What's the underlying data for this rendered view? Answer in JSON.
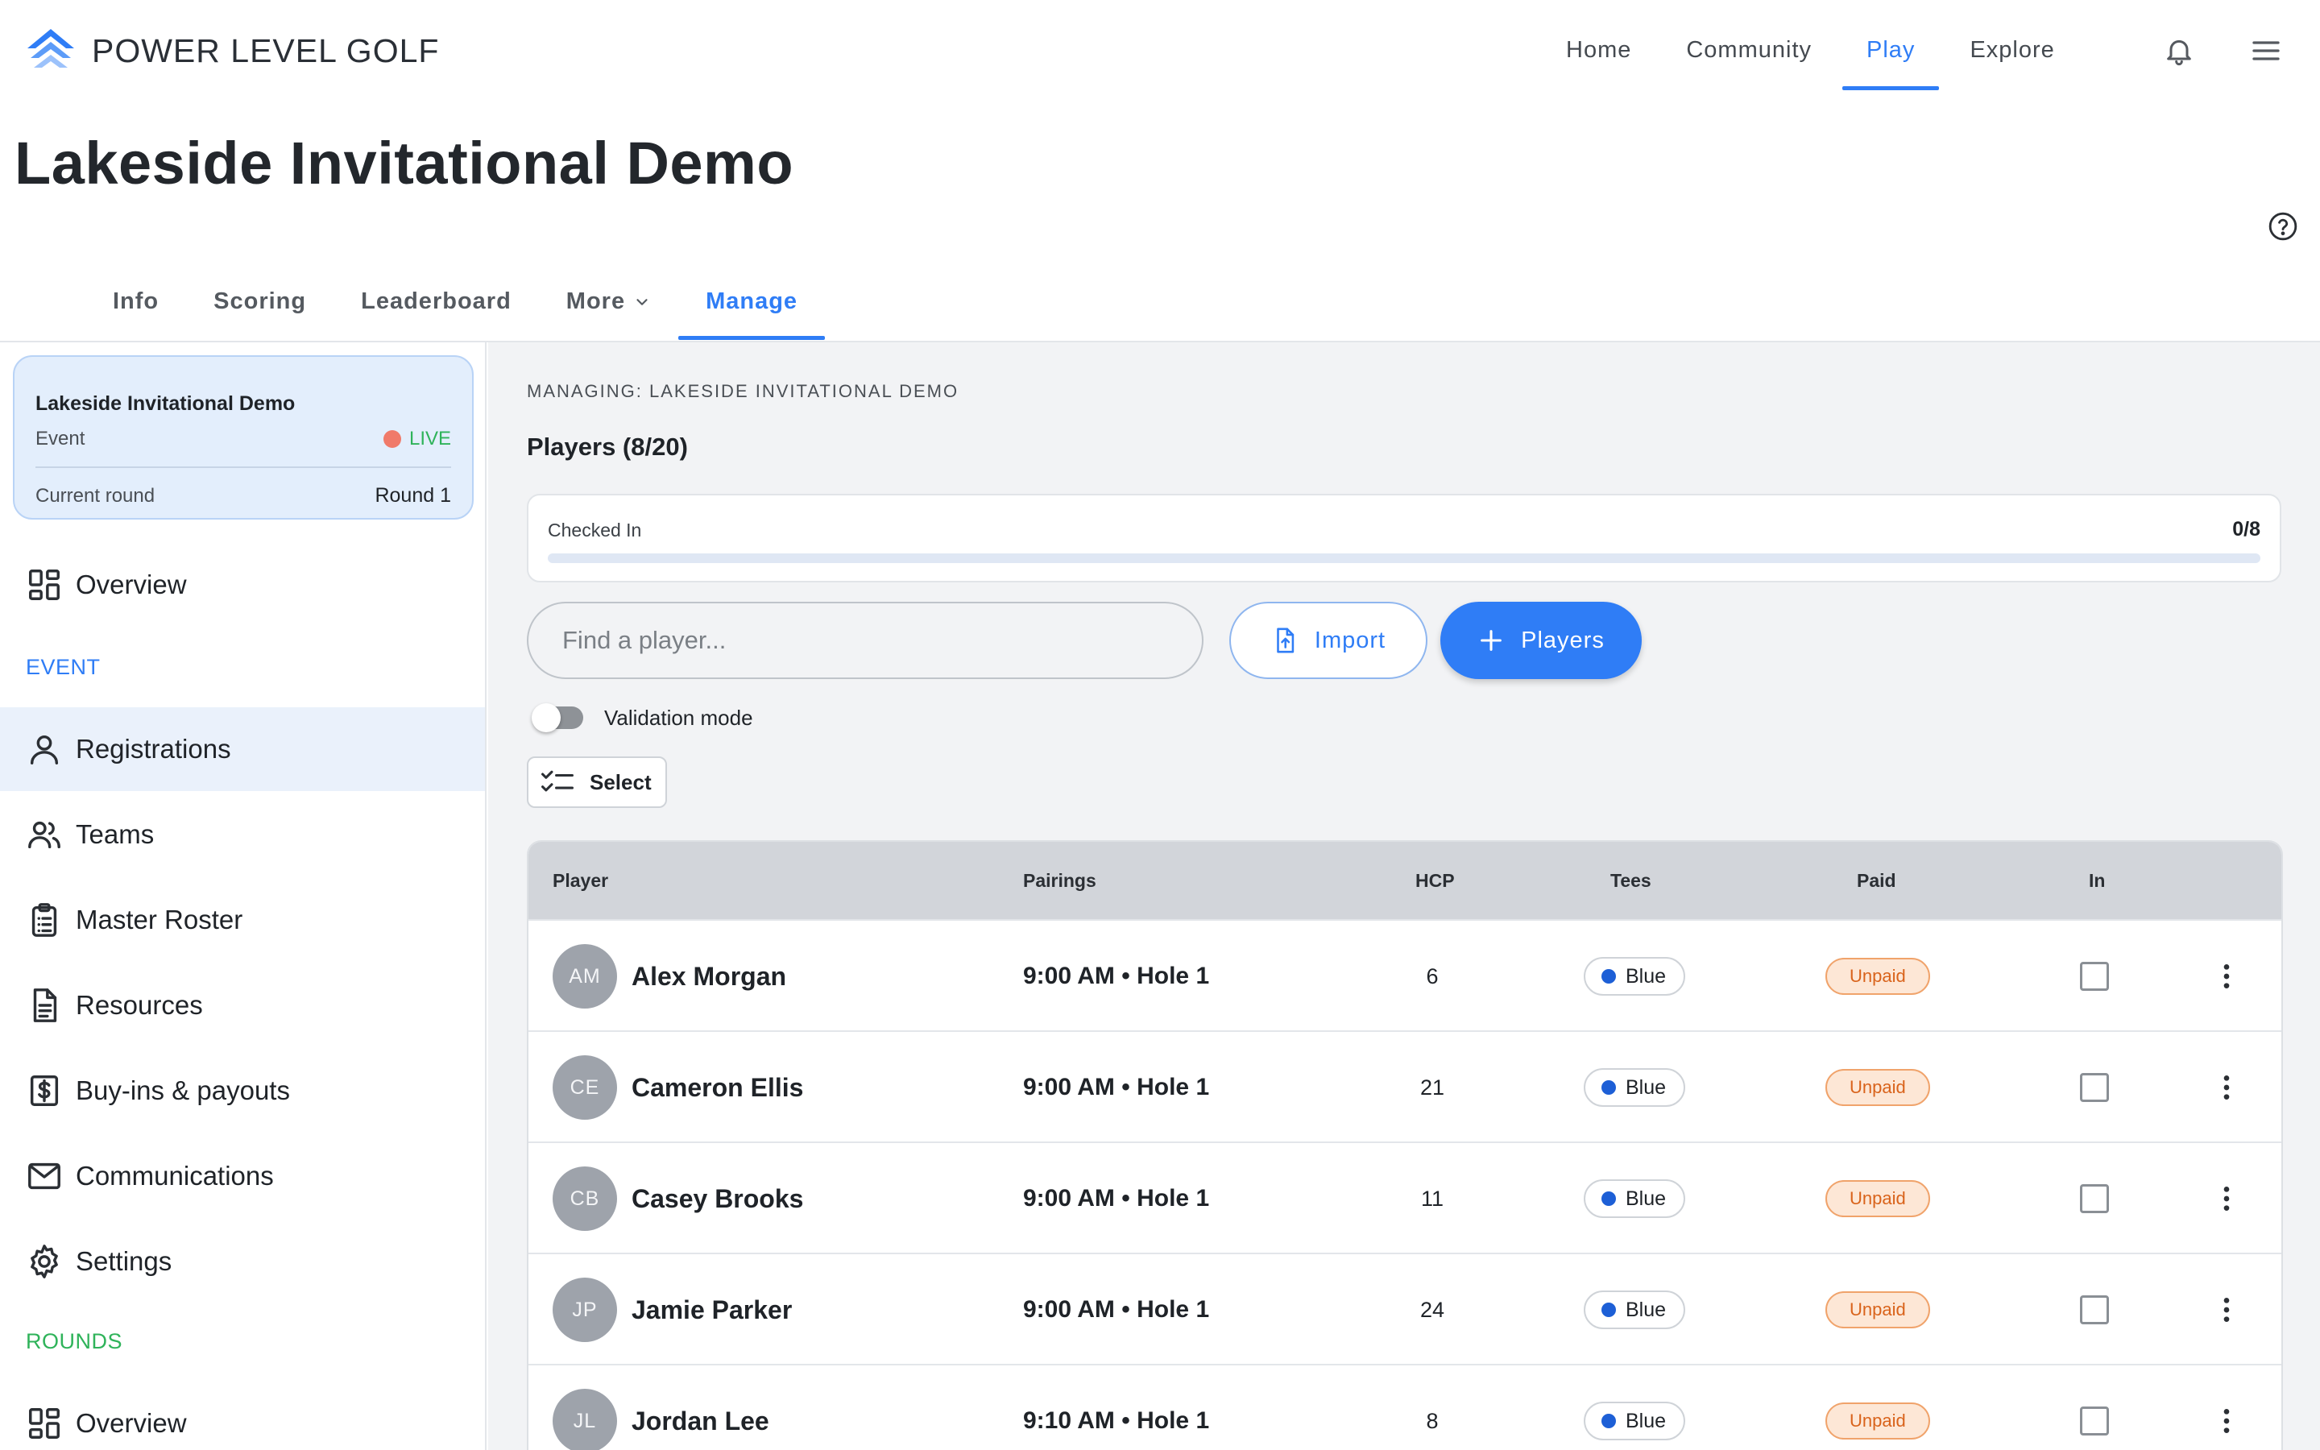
{
  "brand": {
    "name": "POWER LEVEL GOLF",
    "accent": "#2f7df6",
    "logo_icon": "chevron-stack-logo"
  },
  "topnav": {
    "items": [
      "Home",
      "Community",
      "Play",
      "Explore"
    ],
    "active": "Play",
    "notifications_icon": "bell-icon",
    "menu_icon": "hamburger-menu-icon"
  },
  "page": {
    "title": "Lakeside Invitational Demo",
    "help_icon": "question-circle-icon"
  },
  "tabs": {
    "items": [
      "Info",
      "Scoring",
      "Leaderboard",
      "More",
      "Manage"
    ],
    "active": "Manage"
  },
  "sidebar": {
    "event_card": {
      "title": "Lakeside Invitational Demo",
      "type": "Event",
      "status": "LIVE",
      "round_label": "Current round",
      "round_value": "Round 1"
    },
    "overview_label": "Overview",
    "event_section": "EVENT",
    "event_items": [
      {
        "label": "Registrations",
        "icon": "person-icon",
        "active": true
      },
      {
        "label": "Teams",
        "icon": "people-icon"
      },
      {
        "label": "Master Roster",
        "icon": "clipboard-list-icon"
      },
      {
        "label": "Resources",
        "icon": "document-icon"
      },
      {
        "label": "Buy-ins & payouts",
        "icon": "dollar-icon"
      },
      {
        "label": "Communications",
        "icon": "envelope-icon"
      },
      {
        "label": "Settings",
        "icon": "gear-icon"
      }
    ],
    "rounds_section": "ROUNDS",
    "rounds_overview_label": "Overview"
  },
  "main": {
    "managing": "MANAGING: LAKESIDE INVITATIONAL DEMO",
    "players_title": "Players (8/20)",
    "checked_in": {
      "label": "Checked In",
      "value": "0/8",
      "progress": 0
    },
    "search_placeholder": "Find a player...",
    "import_label": "Import",
    "add_players_label": "Players",
    "validation_label": "Validation mode",
    "validation_on": false,
    "select_label": "Select"
  },
  "table": {
    "columns": [
      "Player",
      "Pairings",
      "HCP",
      "Tees",
      "Paid",
      "In"
    ],
    "rows": [
      {
        "initials": "AM",
        "name": "Alex Morgan",
        "pairing": "9:00 AM • Hole 1",
        "hcp": "6",
        "tee": "Blue",
        "paid": "Unpaid",
        "checked_in": false
      },
      {
        "initials": "CE",
        "name": "Cameron Ellis",
        "pairing": "9:00 AM • Hole 1",
        "hcp": "21",
        "tee": "Blue",
        "paid": "Unpaid",
        "checked_in": false
      },
      {
        "initials": "CB",
        "name": "Casey Brooks",
        "pairing": "9:00 AM • Hole 1",
        "hcp": "11",
        "tee": "Blue",
        "paid": "Unpaid",
        "checked_in": false
      },
      {
        "initials": "JP",
        "name": "Jamie Parker",
        "pairing": "9:00 AM • Hole 1",
        "hcp": "24",
        "tee": "Blue",
        "paid": "Unpaid",
        "checked_in": false
      },
      {
        "initials": "JL",
        "name": "Jordan Lee",
        "pairing": "9:10 AM • Hole 1",
        "hcp": "8",
        "tee": "Blue",
        "paid": "Unpaid",
        "checked_in": false
      }
    ]
  }
}
